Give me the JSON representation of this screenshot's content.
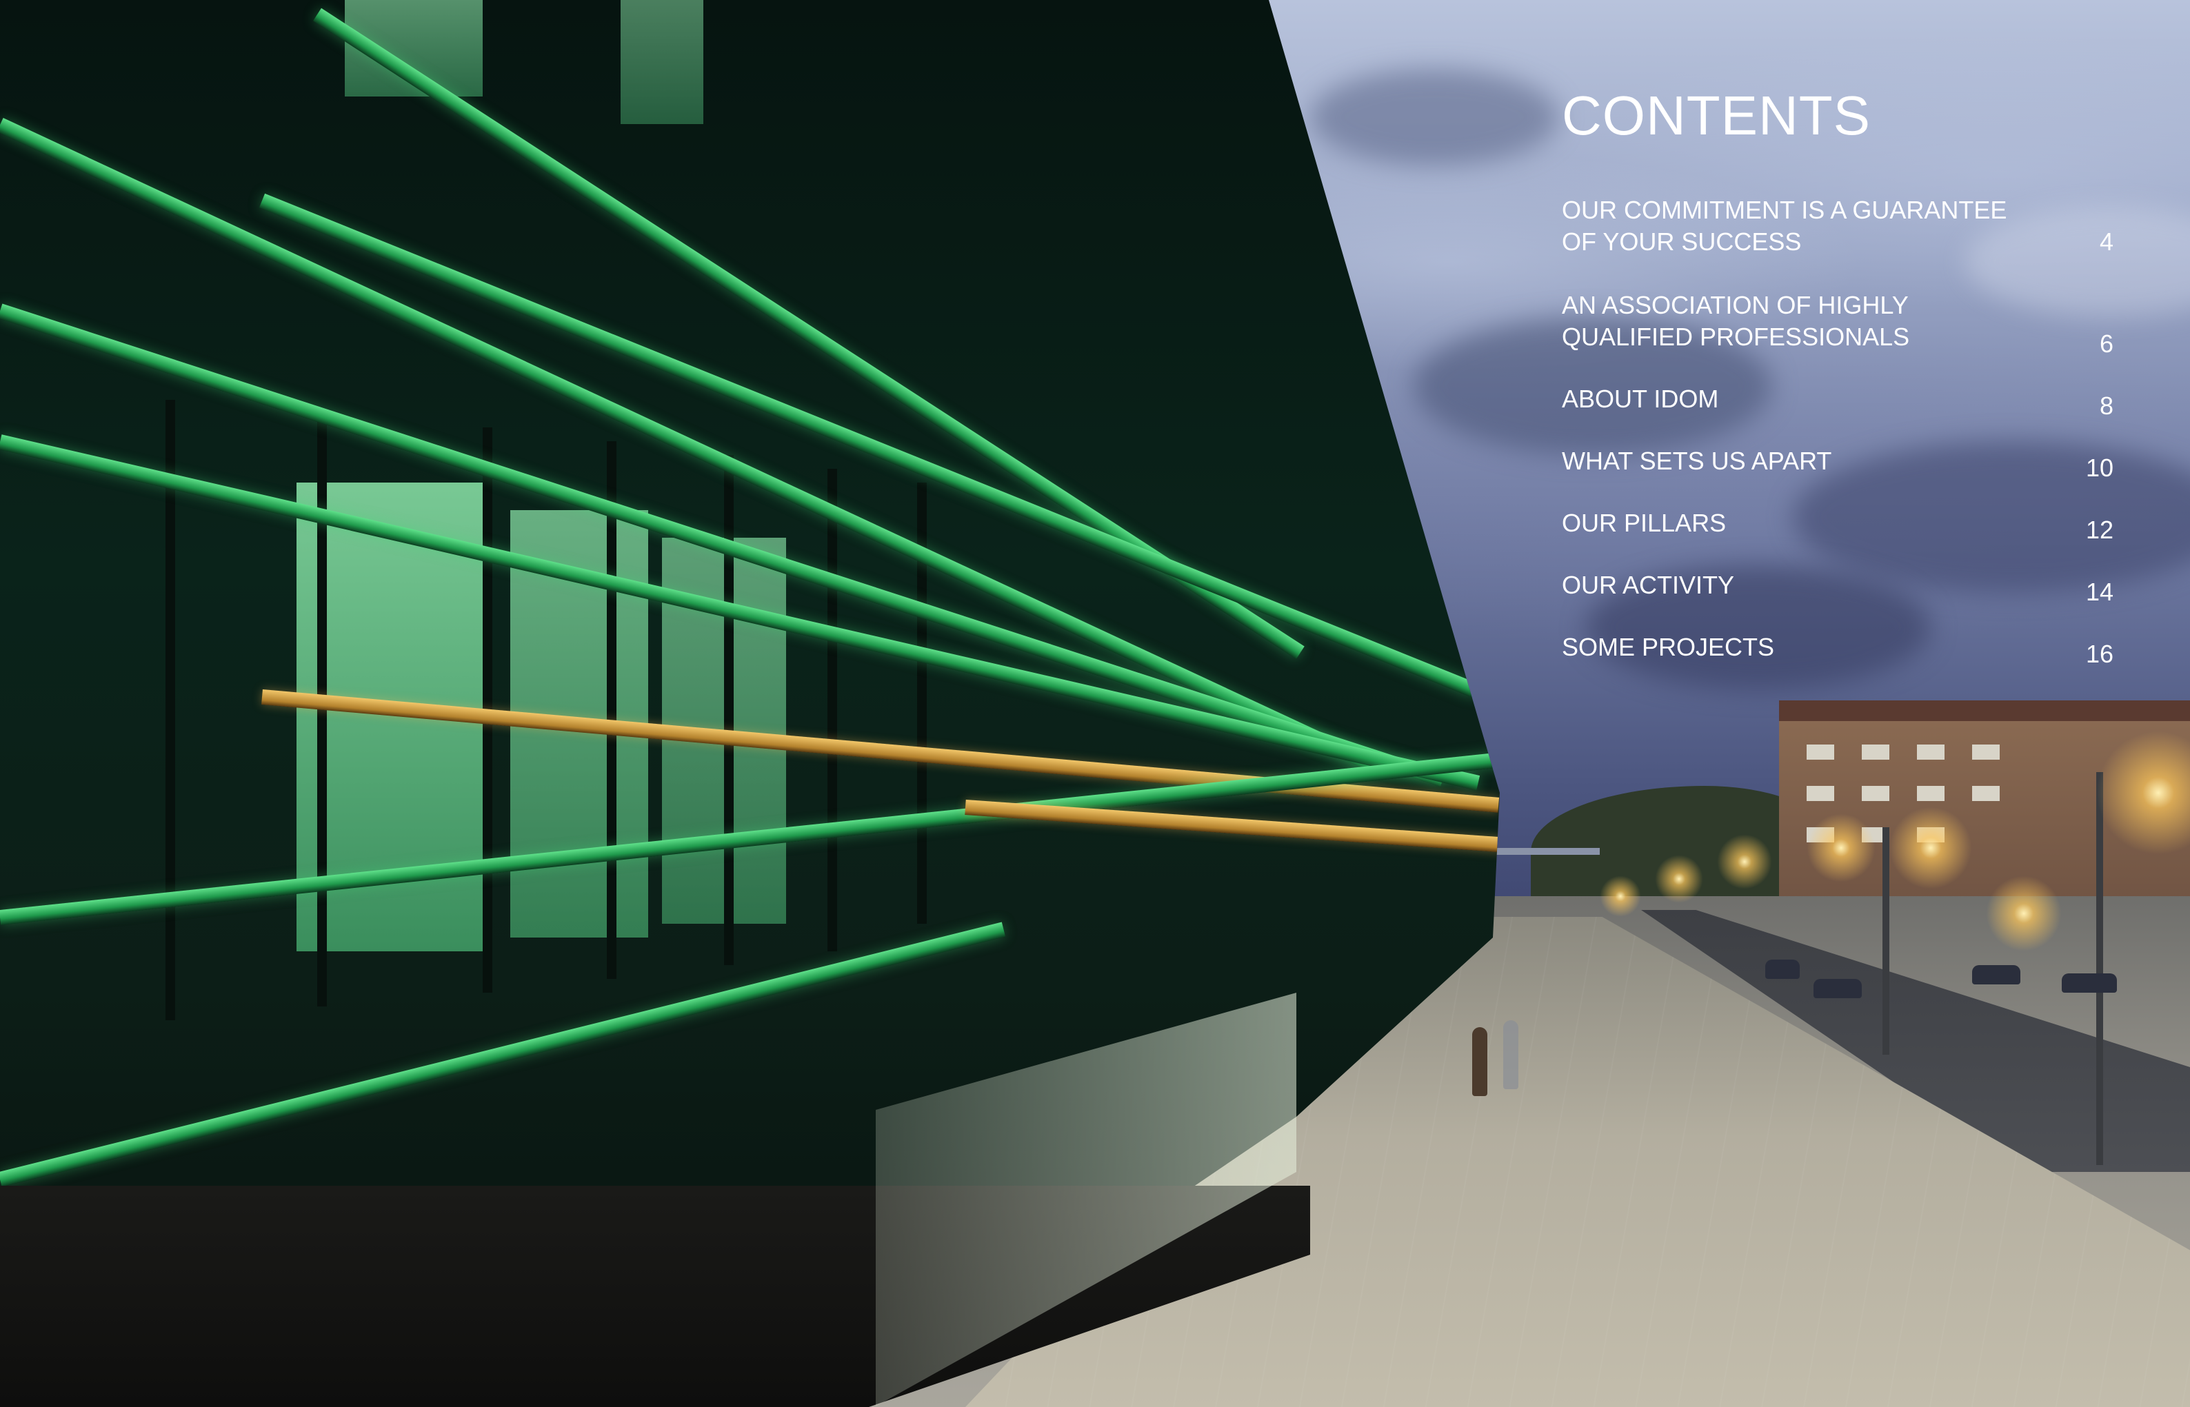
{
  "contents": {
    "title": "CONTENTS",
    "items": [
      {
        "label": "OUR COMMITMENT IS A GUARANTEE OF YOUR SUCCESS",
        "page": "4"
      },
      {
        "label": "AN ASSOCIATION OF HIGHLY QUALIFIED PROFESSIONALS",
        "page": "6"
      },
      {
        "label": "ABOUT IDOM",
        "page": "8"
      },
      {
        "label": "WHAT SETS US APART",
        "page": "10"
      },
      {
        "label": "OUR PILLARS",
        "page": "12"
      },
      {
        "label": "OUR ACTIVITY",
        "page": "14"
      },
      {
        "label": "SOME PROJECTS",
        "page": "16"
      }
    ]
  },
  "colors": {
    "text": "#ffffff",
    "facade_green": "#3fcf75",
    "sky_blue": "#6f7aa2"
  }
}
